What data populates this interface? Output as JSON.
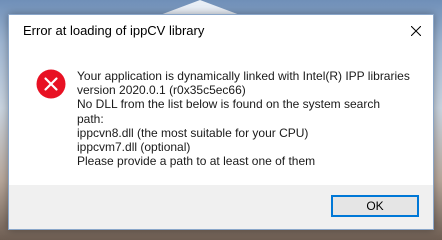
{
  "dialog": {
    "title": "Error at loading of ippCV library",
    "icon": "error-icon",
    "message_lines": [
      "Your application is dynamically linked with Intel(R) IPP libraries",
      "version 2020.0.1 (r0x35c5ec66)",
      "No DLL from the list below is found on the system search",
      "path:",
      "ippcvn8.dll (the most suitable for your CPU)",
      "ippcvm7.dll (optional)",
      "Please provide a path to at least one of them"
    ],
    "ok_label": "OK",
    "close_icon": "close-icon"
  },
  "colors": {
    "error_red": "#e81123",
    "accent": "#0078d7"
  }
}
